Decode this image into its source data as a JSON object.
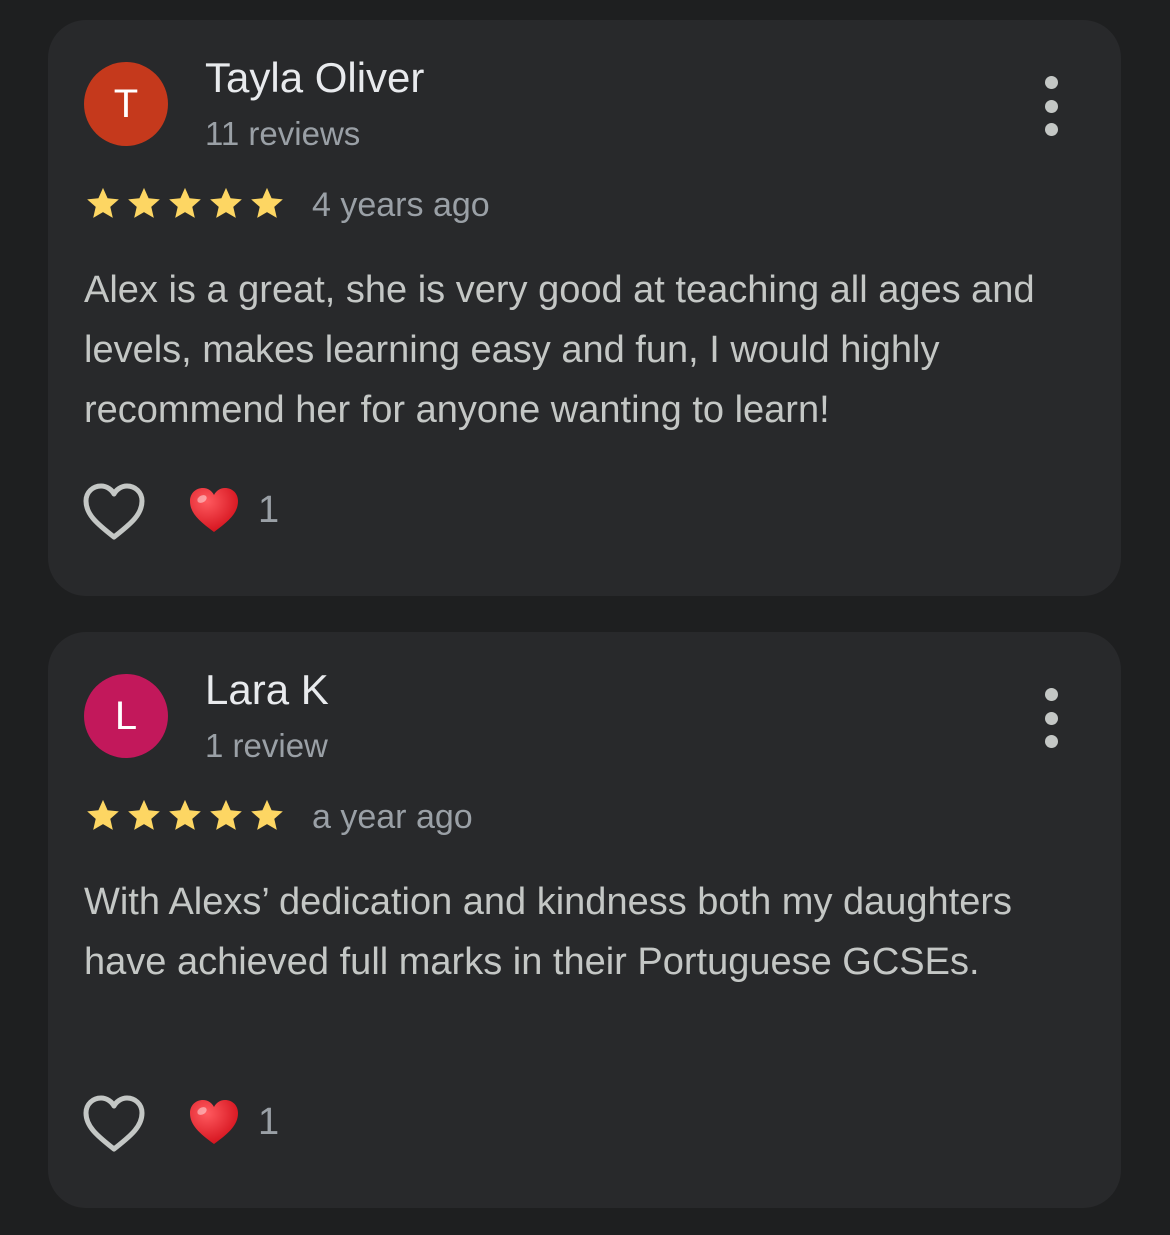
{
  "colors": {
    "background": "#1e1f20",
    "card": "#28292b",
    "star": "#fdd663",
    "reaction_heart": "#e8202a"
  },
  "reviews": [
    {
      "author": "Tayla Oliver",
      "initial": "T",
      "avatar_color": "#c5391c",
      "review_count": "11 reviews",
      "rating": 5,
      "time_ago": "4 years ago",
      "text": "Alex is a great, she is very good at teaching all ages and levels, makes learning easy and fun, I would highly recommend her for anyone wanting to learn!",
      "like_icon": "heart-outline-icon",
      "reaction_icon": "red-heart-emoji",
      "reaction_count": "1"
    },
    {
      "author": "Lara K",
      "initial": "L",
      "avatar_color": "#c2185b",
      "review_count": "1 review",
      "rating": 5,
      "time_ago": "a year ago",
      "text": "With Alexs’ dedication and kindness both my daughters have achieved full marks in their Portuguese GCSEs.",
      "like_icon": "heart-outline-icon",
      "reaction_icon": "red-heart-emoji",
      "reaction_count": "1"
    }
  ]
}
